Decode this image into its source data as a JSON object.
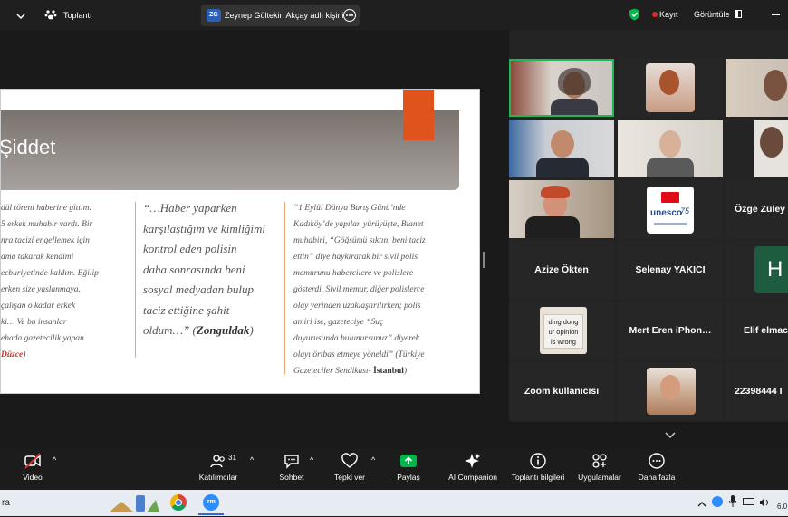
{
  "topbar": {
    "meeting_label": "Toplantı",
    "share_badge": "ZG",
    "share_text": "Zeynep Gültekin Akçay adlı kişini",
    "record_label": "Kayıt",
    "view_label": "Görüntüle"
  },
  "slide": {
    "title": "Şiddet",
    "col1_lines": [
      "dül töreni haberine gittim.",
      "5 erkek muhabir vardı. Bir",
      "nra tacizi engellemek için",
      "ama takarak kendimi",
      "ecburiyetinde kaldım. Eğilip",
      "erken size yaslanmaya,",
      "çalışan o kadar erkek",
      "ki… Ve bu insanlar",
      "ehada gazetecilik yapan"
    ],
    "col1_source": "Düzce",
    "col2_lines": [
      "“…Haber yaparken",
      "karşılaştığım ve kimliğimi",
      "kontrol eden polisin",
      "daha sonrasında beni",
      "sosyal medyadan bulup",
      "taciz ettiğine şahit",
      "oldum…” "
    ],
    "col2_source": "Zonguldak",
    "col3_lines": [
      "“1 Eylül Dünya Barış Günü’nde",
      "Kadıköy’de yapılan yürüyüşte, Bianet",
      "muhabiri, “Göğsümü sıktın, beni taciz",
      "ettin” diye haykırarak bir sivil polis",
      "memurunu habercilere ve polislere",
      "gösterdi. Sivil memur, diğer polislerce",
      "olay yerinden uzaklaştırılırken; polis",
      "amiri ise, gazeteciye “Suç",
      "duyurusunda bulunursunuz” diyerek",
      "olayı örtbas etmeye yöneldi” (Türkiye"
    ],
    "col3_last": "Gazeteciler Sendikası- ",
    "col3_source": "İstanbul"
  },
  "gallery": {
    "tile_ozge": "Özge  Züley",
    "tile_azize": "Azize Ökten",
    "tile_selenay": "Selenay YAKICI",
    "tile_h": "H",
    "tile_mert": "Mert  Eren  iPhon…",
    "tile_elif": "Elif elmac",
    "tile_zoom": "Zoom kullanıcısı",
    "tile_num": "22398444 I",
    "unesco_text": "unesco",
    "unesco_75": "75",
    "sign_lines": [
      "ding dong",
      "ur opinion",
      "is wrong"
    ]
  },
  "toolbar": {
    "video": "Video",
    "participants": "Katılımcılar",
    "participants_count": "31",
    "chat": "Sohbet",
    "react": "Tepki ver",
    "share": "Paylaş",
    "ai": "AI Companion",
    "info": "Toplantı bilgileri",
    "apps": "Uygulamalar",
    "more": "Daha fazla"
  },
  "taskbar": {
    "search_fragment": "ra",
    "clock_fragment": "6.0"
  },
  "colors": {
    "accent_green": "#00b84a",
    "record_red": "#e02828",
    "slide_orange": "#e0531d",
    "active_speaker": "#1db954"
  }
}
